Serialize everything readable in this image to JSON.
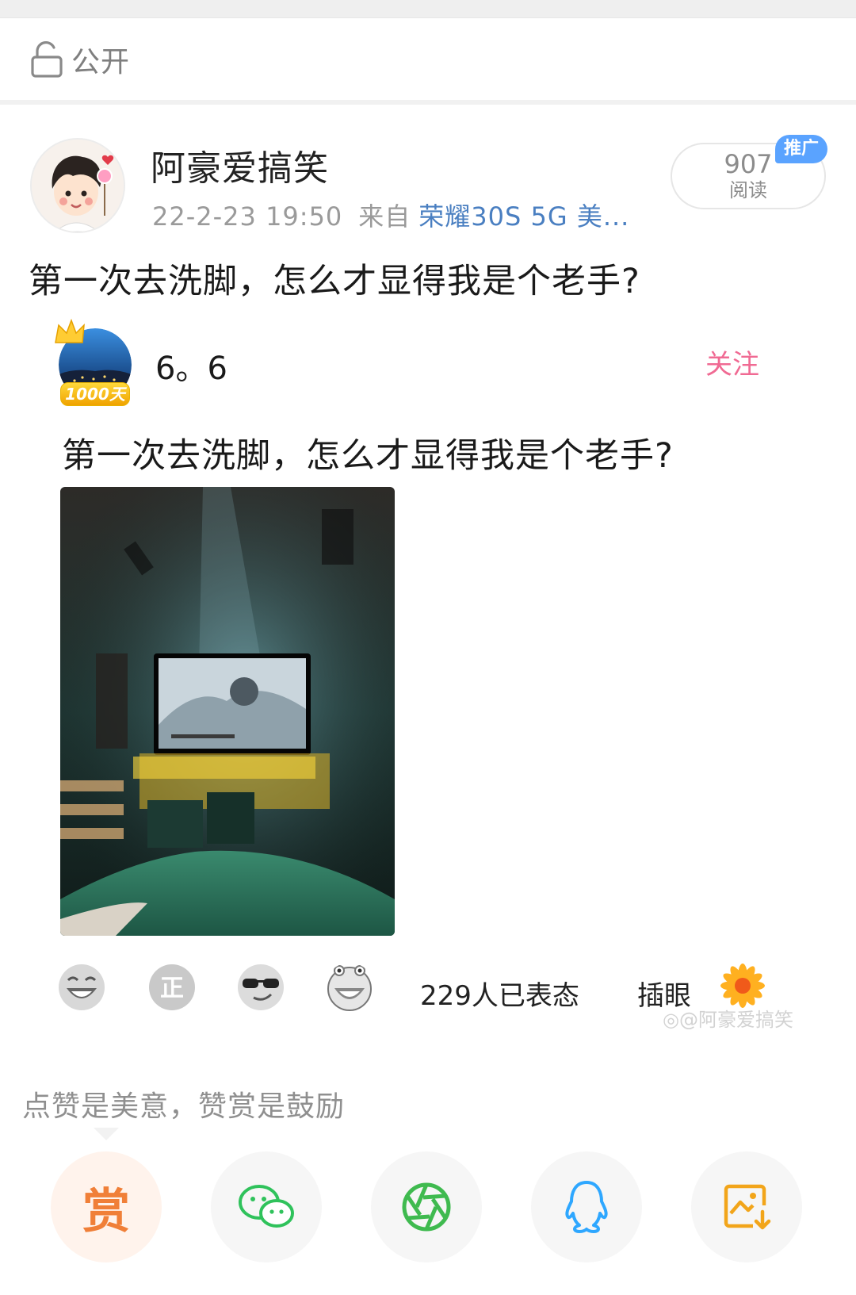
{
  "visibility": {
    "label": "公开",
    "icon": "unlock-icon"
  },
  "post": {
    "author": "阿豪爱搞笑",
    "time": "22-2-23 19:50",
    "source_prefix": "来自",
    "device": "荣耀30S 5G 美...",
    "reads_count": "907",
    "reads_label": "阅读",
    "promo_badge": "推广",
    "text": "第一次去洗脚，怎么才显得我是个老手?"
  },
  "repost": {
    "author": "6。6",
    "badge": "1000天",
    "follow_label": "关注",
    "text": "第一次去洗脚，怎么才显得我是个老手?"
  },
  "reactions": {
    "icons": [
      "laughing-face-icon",
      "zheng-face-icon",
      "sunglasses-face-icon",
      "grinning-face-icon"
    ],
    "count_text": "229人已表态",
    "comment_label": "插眼",
    "watermark": "@阿豪爱搞笑"
  },
  "reward_tip": "点赞是美意，赞赏是鼓励",
  "share": [
    {
      "name": "reward",
      "label": "赏",
      "icon": "reward-icon",
      "color": "#f07f38"
    },
    {
      "name": "wechat",
      "icon": "wechat-icon",
      "color": "#2fc25b"
    },
    {
      "name": "moments",
      "icon": "moments-icon",
      "color": "#3fba4f"
    },
    {
      "name": "qq",
      "icon": "qq-icon",
      "color": "#2ea7ff"
    },
    {
      "name": "save-image",
      "icon": "save-image-icon",
      "color": "#f2a51a"
    }
  ]
}
